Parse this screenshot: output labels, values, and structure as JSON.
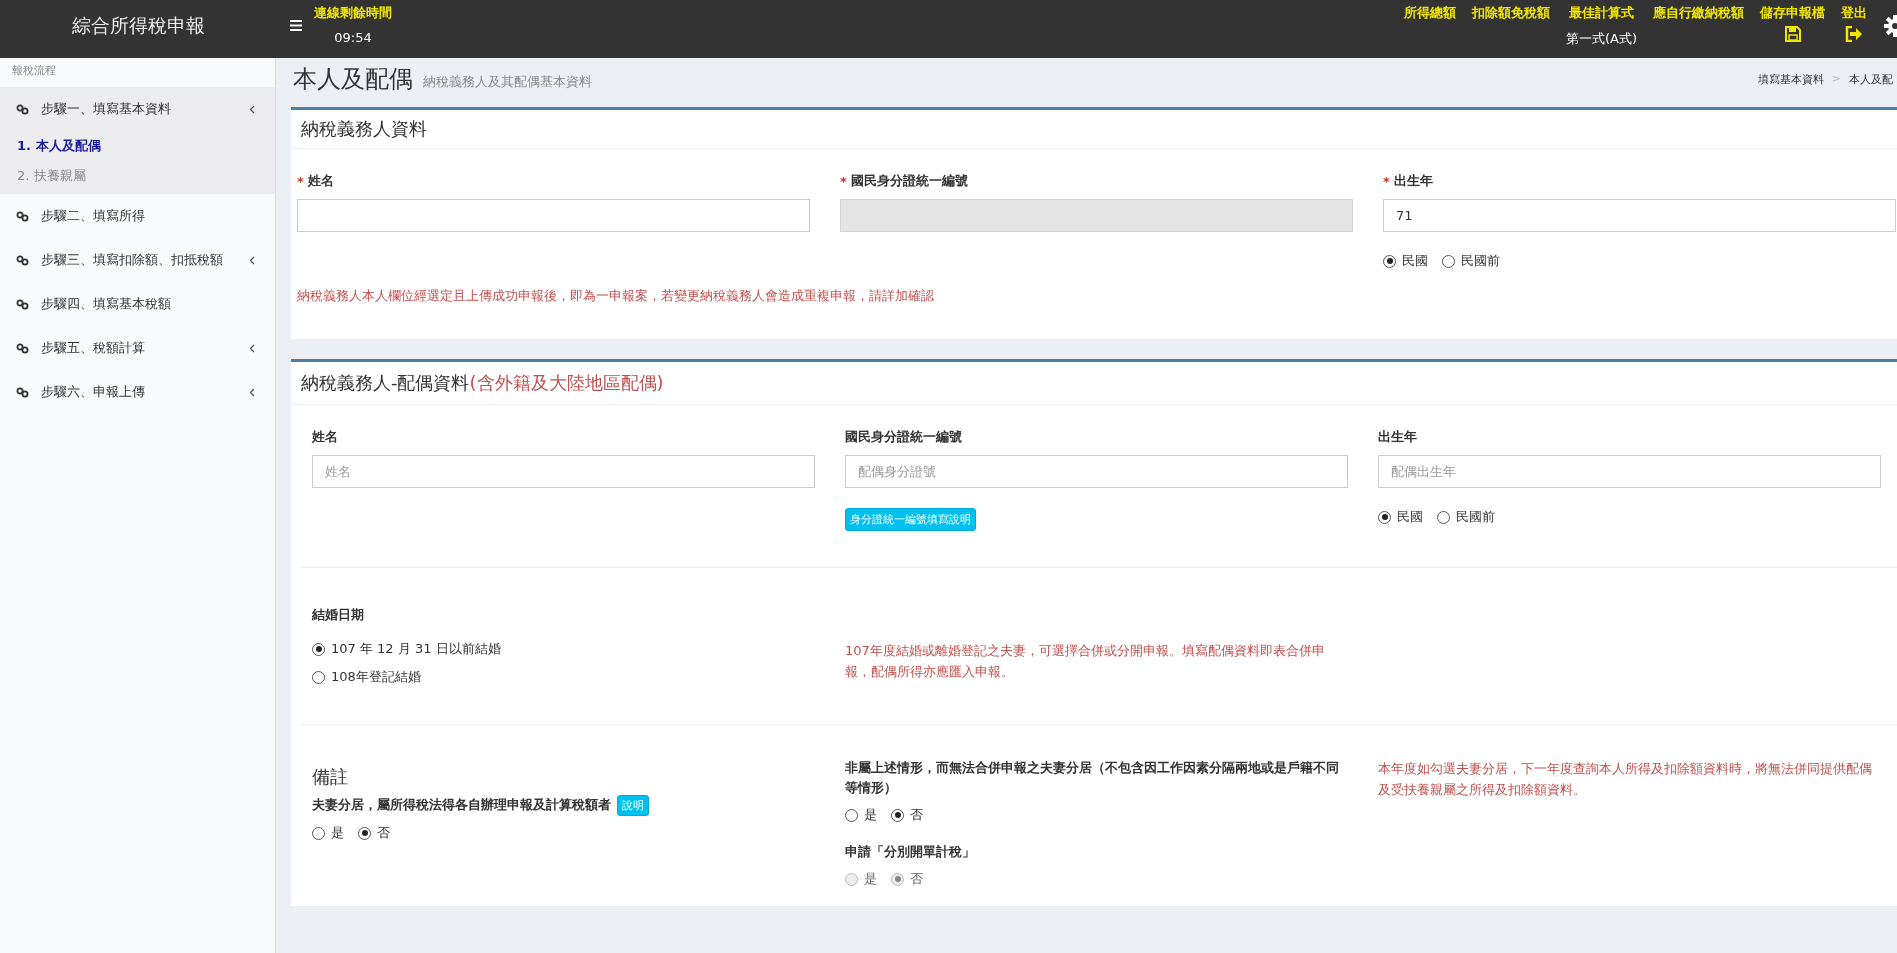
{
  "app": {
    "title": "綜合所得稅申報",
    "timer_label": "連線剩餘時間",
    "timer": "09:54"
  },
  "toolbar": [
    {
      "kind": "label",
      "label": "所得總額"
    },
    {
      "kind": "label",
      "label": "扣除額免稅額"
    },
    {
      "kind": "label",
      "label": "最佳計算式",
      "value": "第一式(A式)"
    },
    {
      "kind": "label",
      "label": "應自行繳納稅額"
    },
    {
      "kind": "save",
      "label": "儲存申報檔"
    },
    {
      "kind": "logout",
      "label": "登出"
    },
    {
      "kind": "settings"
    }
  ],
  "sidebar": {
    "heading": "報稅流程",
    "items": [
      {
        "label": "步驟一、填寫基本資料",
        "has_submenu": true,
        "expanded": true,
        "children": [
          {
            "label": "1. 本人及配偶",
            "selected": true
          },
          {
            "label": "2. 扶養親屬",
            "selected": false
          }
        ]
      },
      {
        "label": "步驟二、填寫所得",
        "has_submenu": false,
        "expanded": false
      },
      {
        "label": "步驟三、填寫扣除額、扣抵稅額",
        "has_submenu": true,
        "expanded": false
      },
      {
        "label": "步驟四、填寫基本稅額",
        "has_submenu": false,
        "expanded": false
      },
      {
        "label": "步驟五、稅額計算",
        "has_submenu": true,
        "expanded": false
      },
      {
        "label": "步驟六、申報上傳",
        "has_submenu": true,
        "expanded": false
      }
    ]
  },
  "page": {
    "title": "本人及配偶",
    "subtitle": "納稅義務人及其配偶基本資料",
    "breadcrumb": [
      "填寫基本資料",
      "本人及配"
    ],
    "breadcrumb_separator": ">"
  },
  "taxpayer": {
    "title": "納稅義務人資料",
    "fields": [
      {
        "label": "姓名",
        "required_mark": "*",
        "disabled": false
      },
      {
        "label": "國民身分證統一編號",
        "required_mark": "*",
        "disabled": true
      },
      {
        "label": "出生年",
        "required_mark": "*",
        "value": "71",
        "disabled": false,
        "radios": [
          {
            "label": "民國",
            "selected": true,
            "disabled": false
          },
          {
            "label": "民國前",
            "selected": false,
            "disabled": false
          }
        ]
      }
    ],
    "notice": "納稅義務人本人欄位經選定且上傳成功申報後，即為一申報案，若變更納稅義務人會造成重複申報，請詳加確認"
  },
  "spouse": {
    "title": "納稅義務人-配偶資料",
    "title_note": "(含外籍及大陸地區配偶)",
    "fields": [
      {
        "label": "姓名",
        "placeholder": "姓名",
        "disabled": false
      },
      {
        "label": "國民身分證統一編號",
        "placeholder": "配偶身分證號",
        "disabled": false,
        "help_button": "身分證統一編號填寫說明"
      },
      {
        "label": "出生年",
        "placeholder": "配偶出生年",
        "disabled": false,
        "radios": [
          {
            "label": "民國",
            "selected": true,
            "disabled": false
          },
          {
            "label": "民國前",
            "selected": false,
            "disabled": false
          }
        ]
      }
    ],
    "marriage": {
      "label": "結婚日期",
      "radios": [
        {
          "label": "107 年 12 月 31 日以前結婚",
          "selected": true,
          "disabled": false
        },
        {
          "label": "108年登記結婚",
          "selected": false,
          "disabled": false
        }
      ],
      "note": "107年度結婚或離婚登記之夫妻，可選擇合併或分開申報。填寫配偶資料即表合併申報，配偶所得亦應匯入申報。"
    },
    "remarks": {
      "title": "備註",
      "separated": {
        "label": "夫妻分居，屬所得稅法得各自辦理申報及計算稅額者",
        "help_button": "說明",
        "radios": [
          {
            "label": "是",
            "selected": false,
            "disabled": false
          },
          {
            "label": "否",
            "selected": true,
            "disabled": false
          }
        ]
      },
      "other": {
        "label": "非屬上述情形，而無法合併申報之夫妻分居（不包含因工作因素分隔兩地或是戶籍不同等情形）",
        "radios": [
          {
            "label": "是",
            "selected": false,
            "disabled": false
          },
          {
            "label": "否",
            "selected": true,
            "disabled": false
          }
        ]
      },
      "separate_tax": {
        "label": "申請「分別開單計稅」",
        "radios": [
          {
            "label": "是",
            "selected": false,
            "disabled": true
          },
          {
            "label": "否",
            "selected": true,
            "disabled": true
          }
        ]
      },
      "note": "本年度如勾選夫妻分居，下一年度查詢本人所得及扣除額資料時，將無法併同提供配偶及受扶養親屬之所得及扣除額資料。"
    }
  }
}
